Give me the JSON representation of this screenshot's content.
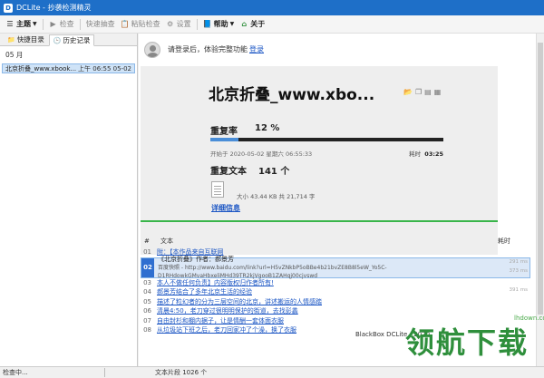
{
  "window": {
    "title": "DCLite - 抄袭检测精灵",
    "icon_letter": "D"
  },
  "toolbar": {
    "main": "主题",
    "check": "检查",
    "quick_check": "快速抽查",
    "paste_check": "粘贴检查",
    "settings": "设置",
    "help": "帮助",
    "about": "关于"
  },
  "left": {
    "tabs": [
      "快捷目录",
      "历史记录"
    ],
    "month": "05 月",
    "history": [
      {
        "title": "北京折叠_www.xbook...",
        "date": "上午 06:55 05-02"
      }
    ]
  },
  "login": {
    "prompt": "请登录后，体验完整功能",
    "link": "登录"
  },
  "report": {
    "title": "北京折叠_www.xbo...",
    "rate_label": "重复率",
    "rate_value": "12 %",
    "rate_fraction": 0.12,
    "start_label": "开始于 2020-05-02 星期六 06:55:33",
    "time_label": "耗时",
    "time_value": "03:25",
    "dup_label": "重复文本",
    "dup_count": "141 个",
    "file_meta": "大小 43.44 KB  共 21,714 字",
    "detail_link": "详细信息"
  },
  "list": {
    "header_num": "#",
    "header_text": "文本",
    "header_time": "耗时",
    "rows": [
      {
        "num": "01",
        "text": "附：【本作品来自互联网"
      },
      {
        "num": "02",
        "title": "《北京折叠》作者：郝景芳",
        "url": "百度快照 - http://www.baidu.com/link?url=H5vZNkbP5oBBe4b21bvZE8B8l5eW_Yo5C-D1RHdowkGMvaHbxeliMHd39TR2kjVgooB1ZAHqj00cjvswd"
      },
      {
        "num": "03",
        "text": "本人不做任何负责】内容版权归作者所有!"
      },
      {
        "num": "04",
        "text": "郝景芳结合了多年北京生活的经验"
      },
      {
        "num": "05",
        "text": "描述了粒幻者的分为三层空间的北京，讲述搬运的人情感踏"
      },
      {
        "num": "06",
        "text": "清晨4:50，老刀穿过很明明保护的街道，去找彭蠡"
      },
      {
        "num": "07",
        "text": "自由封杉和棚内据子，让是情酬一套体面衣服"
      },
      {
        "num": "08",
        "text": "从垃圾站下班之后，老刀回家冲了个澡，换了衣服"
      }
    ],
    "timings": [
      "",
      "291 ms",
      "373 ms",
      "",
      "391 ms",
      "",
      "",
      "",
      "",
      "",
      "",
      ""
    ]
  },
  "watermark": {
    "site": "lhdown.com",
    "big": "领航下载",
    "small": "BlackBox DCLite - 2020"
  },
  "status": {
    "left": "检查中...",
    "right": "文本片段 1026 个"
  }
}
